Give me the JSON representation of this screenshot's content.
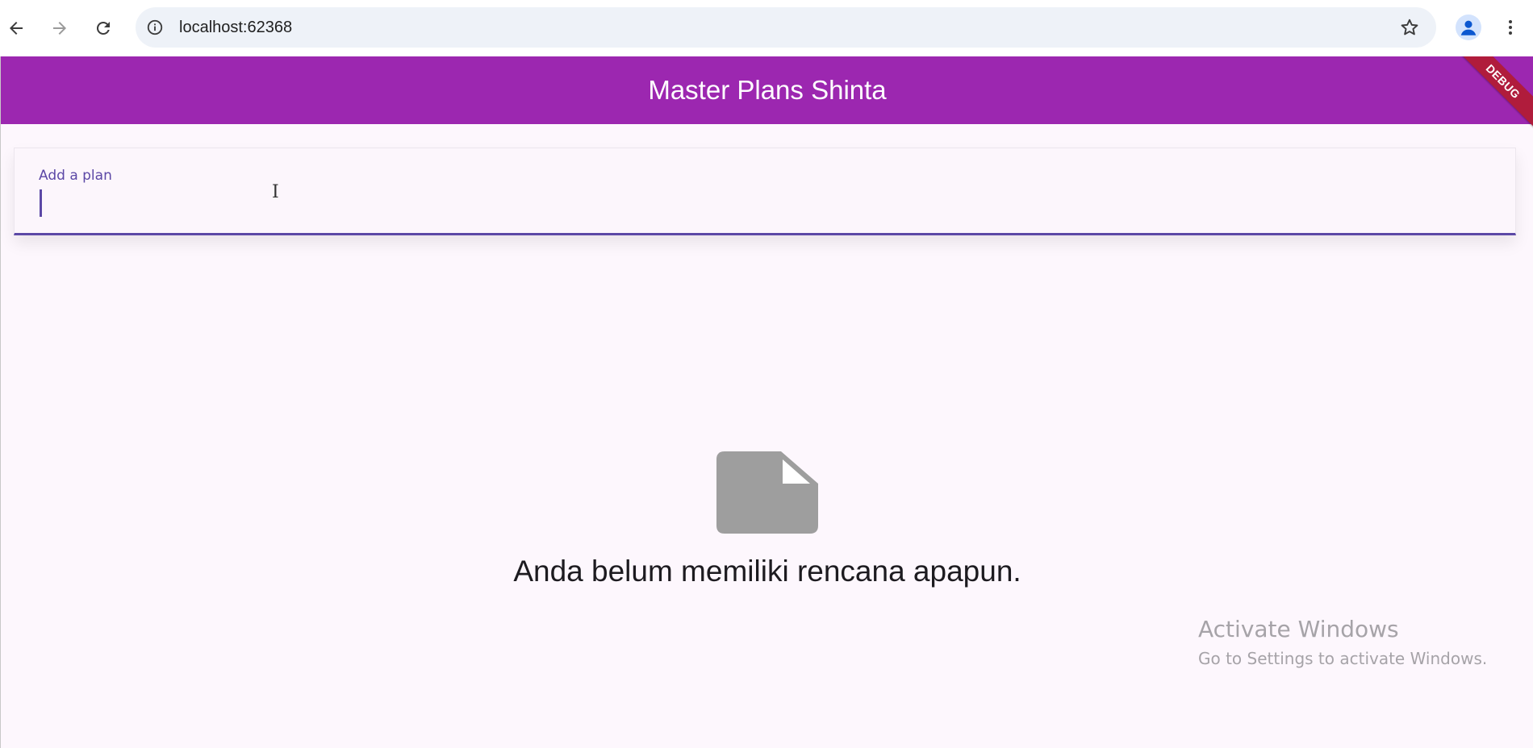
{
  "browser": {
    "url": "localhost:62368",
    "icons": [
      "back-arrow-icon",
      "forward-arrow-icon",
      "reload-icon",
      "info-icon",
      "star-icon",
      "profile-icon",
      "more-vert-icon"
    ]
  },
  "app": {
    "title": "Master Plans Shinta",
    "debug_banner": "DEBUG",
    "appbar_color": "#9c27b0",
    "accent_color": "#5c48a6"
  },
  "plan_input": {
    "label": "Add a plan",
    "value": ""
  },
  "empty_state": {
    "icon": "note-icon",
    "message": "Anda belum memiliki rencana apapun."
  },
  "watermark": {
    "title": "Activate Windows",
    "subtitle": "Go to Settings to activate Windows."
  }
}
